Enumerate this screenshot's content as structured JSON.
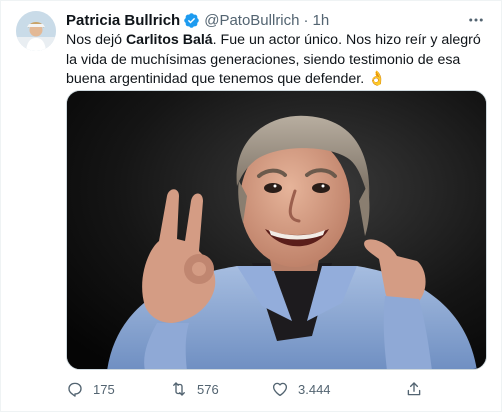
{
  "tweet": {
    "author_name": "Patricia Bullrich",
    "handle": "@PatoBullrich",
    "separator": "·",
    "time": "1h",
    "text_before": "Nos dejó ",
    "text_bold": "Carlitos Balá",
    "text_after": ". Fue un actor único. Nos hizo reír y alegró la vida de muchísimas generaciones, siendo testimonio de esa buena argentinidad que tenemos que defender. ",
    "emoji": "👌",
    "media_alt": "Photo of Carlitos Balá smiling and making an OK gesture"
  },
  "actions": {
    "reply_count": "175",
    "retweet_count": "576",
    "like_count": "3.444"
  },
  "icons": {
    "verified": "verified-badge-icon",
    "more": "more-options-icon",
    "reply": "reply-icon",
    "retweet": "retweet-icon",
    "like": "heart-icon",
    "share": "share-icon"
  },
  "colors": {
    "verified_blue": "#1d9bf0",
    "secondary_text": "#536471",
    "primary_text": "#0f1419"
  }
}
